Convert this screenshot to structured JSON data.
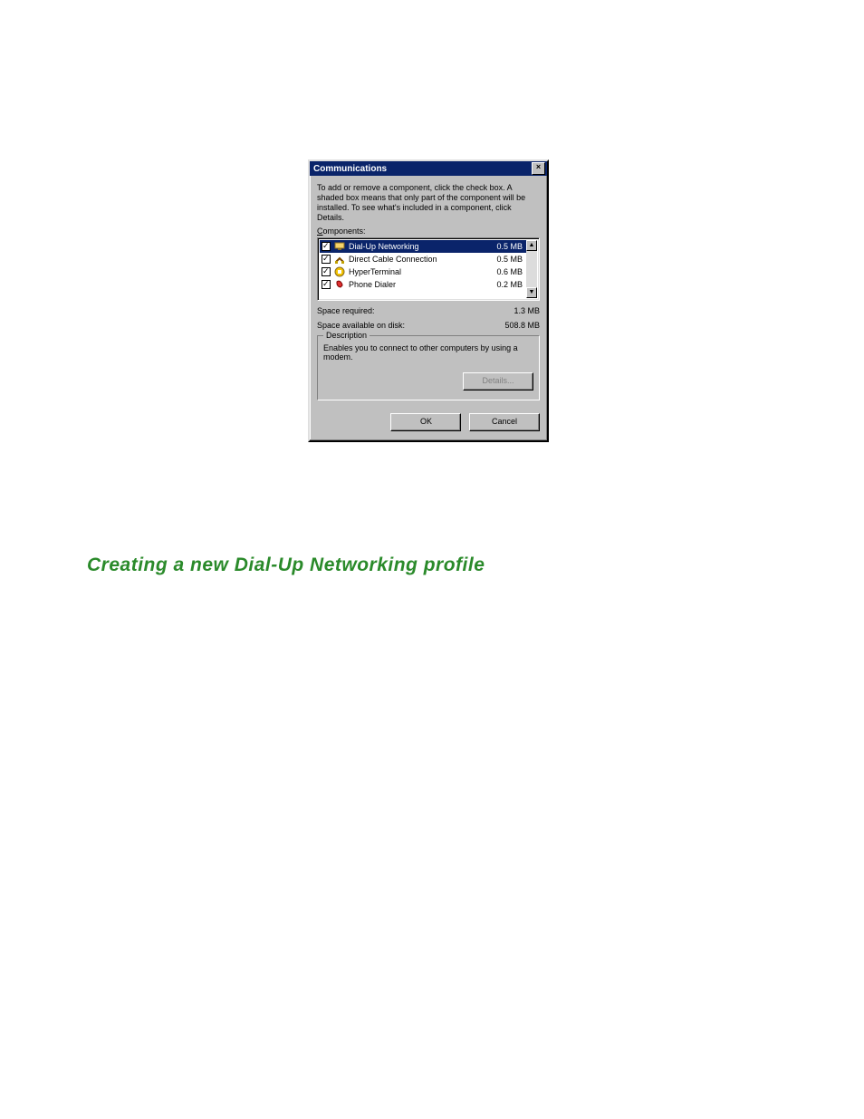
{
  "dialog": {
    "title": "Communications",
    "close_glyph": "×",
    "instruction": "To add or remove a component, click the check box. A shaded box means that only part of the component will be installed. To see what's included in a component, click Details.",
    "components_label": "Components:",
    "items": [
      {
        "name": "Dial-Up Networking",
        "size": "0.5 MB",
        "icon": "network-icon",
        "selected": true
      },
      {
        "name": "Direct Cable Connection",
        "size": "0.5 MB",
        "icon": "cable-icon",
        "selected": false
      },
      {
        "name": "HyperTerminal",
        "size": "0.6 MB",
        "icon": "terminal-icon",
        "selected": false
      },
      {
        "name": "Phone Dialer",
        "size": "0.2 MB",
        "icon": "phone-icon",
        "selected": false
      }
    ],
    "scroll_up_glyph": "▲",
    "scroll_down_glyph": "▼",
    "space_required_label": "Space required:",
    "space_required_value": "1.3 MB",
    "space_available_label": "Space available on disk:",
    "space_available_value": "508.8 MB",
    "description_legend": "Description",
    "description_text": "Enables you to connect to other computers by using a modem.",
    "details_button": "Details...",
    "ok_button": "OK",
    "cancel_button": "Cancel"
  },
  "heading": "Creating a new Dial-Up Networking profile"
}
